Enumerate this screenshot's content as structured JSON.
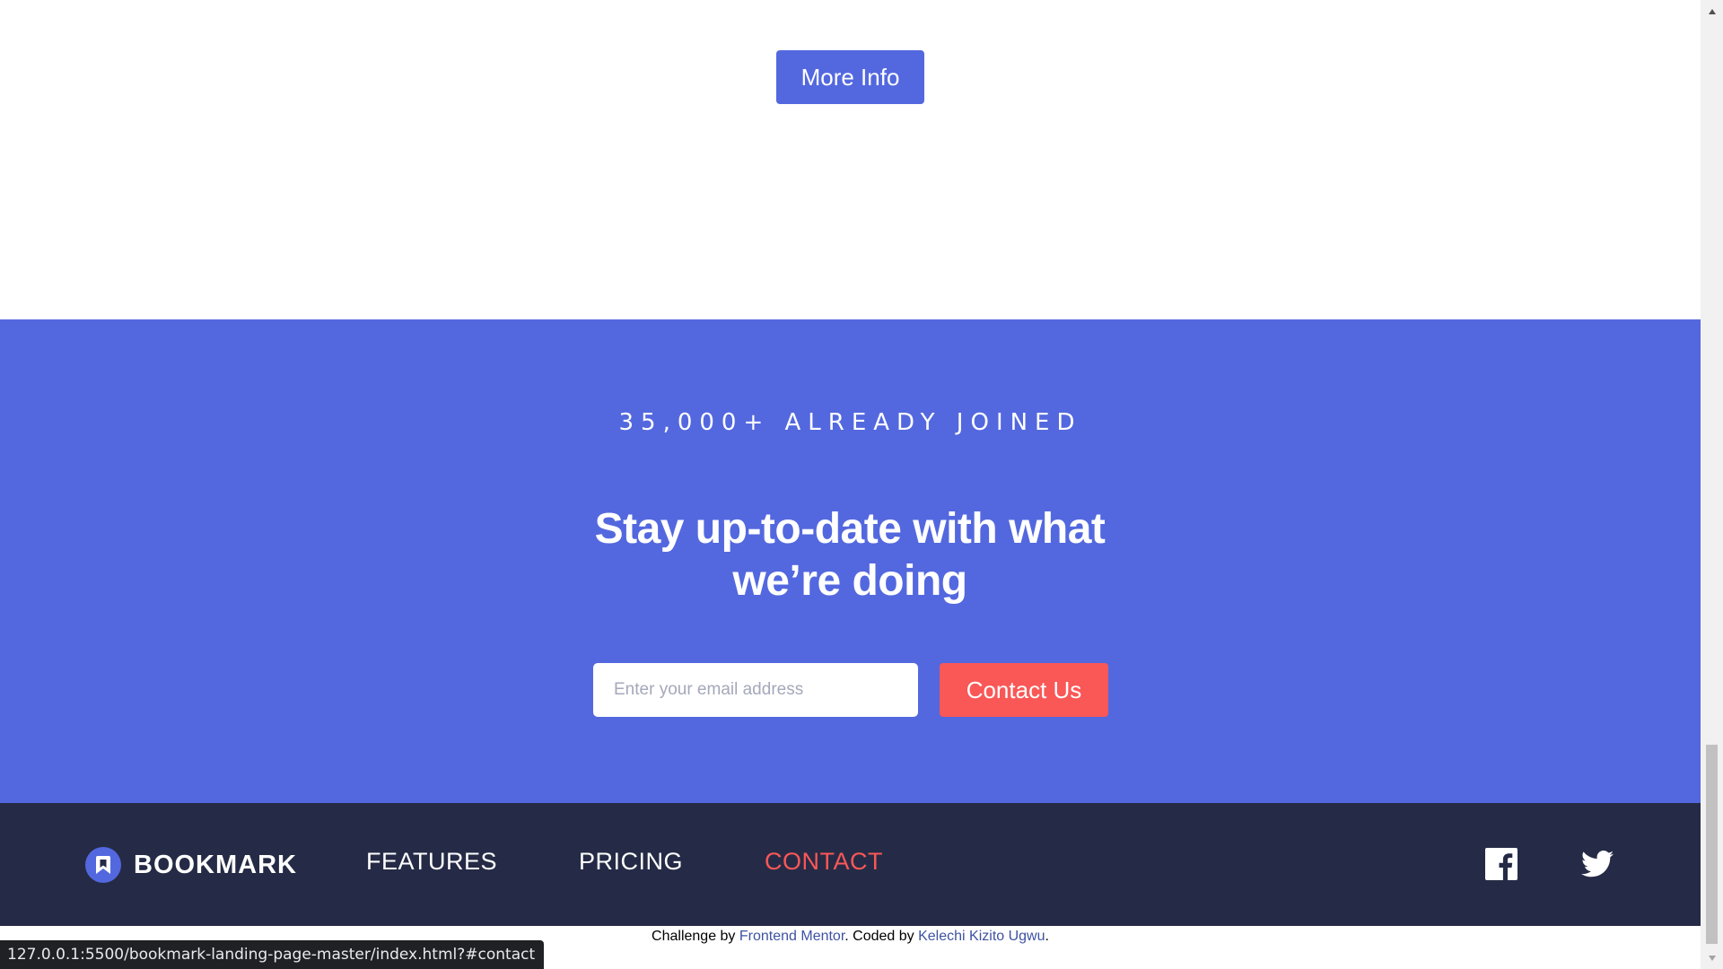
{
  "features": {
    "more_info_label": "More Info"
  },
  "cta": {
    "joined_text": "35,000+ ALREADY JOINED",
    "title": "Stay up-to-date with what we’re doing",
    "email_placeholder": "Enter your email address",
    "email_value": "",
    "contact_label": "Contact Us"
  },
  "footer": {
    "logo_text": "BOOKMARK",
    "nav": [
      {
        "label": "FEATURES"
      },
      {
        "label": "PRICING"
      },
      {
        "label": "CONTACT"
      }
    ],
    "social": [
      "facebook-icon",
      "twitter-icon"
    ]
  },
  "attribution": {
    "prefix": "Challenge by ",
    "mentor": "Frontend Mentor",
    "middle": ". Coded by ",
    "author": "Kelechi Kizito Ugwu",
    "suffix": "."
  },
  "status_bar": {
    "url": "127.0.0.1:5500/bookmark-landing-page-master/index.html?#contact"
  },
  "colors": {
    "primary_blue": "#5368df",
    "soft_red": "#fa5757",
    "dark_navy": "#252b46",
    "white": "#ffffff"
  }
}
